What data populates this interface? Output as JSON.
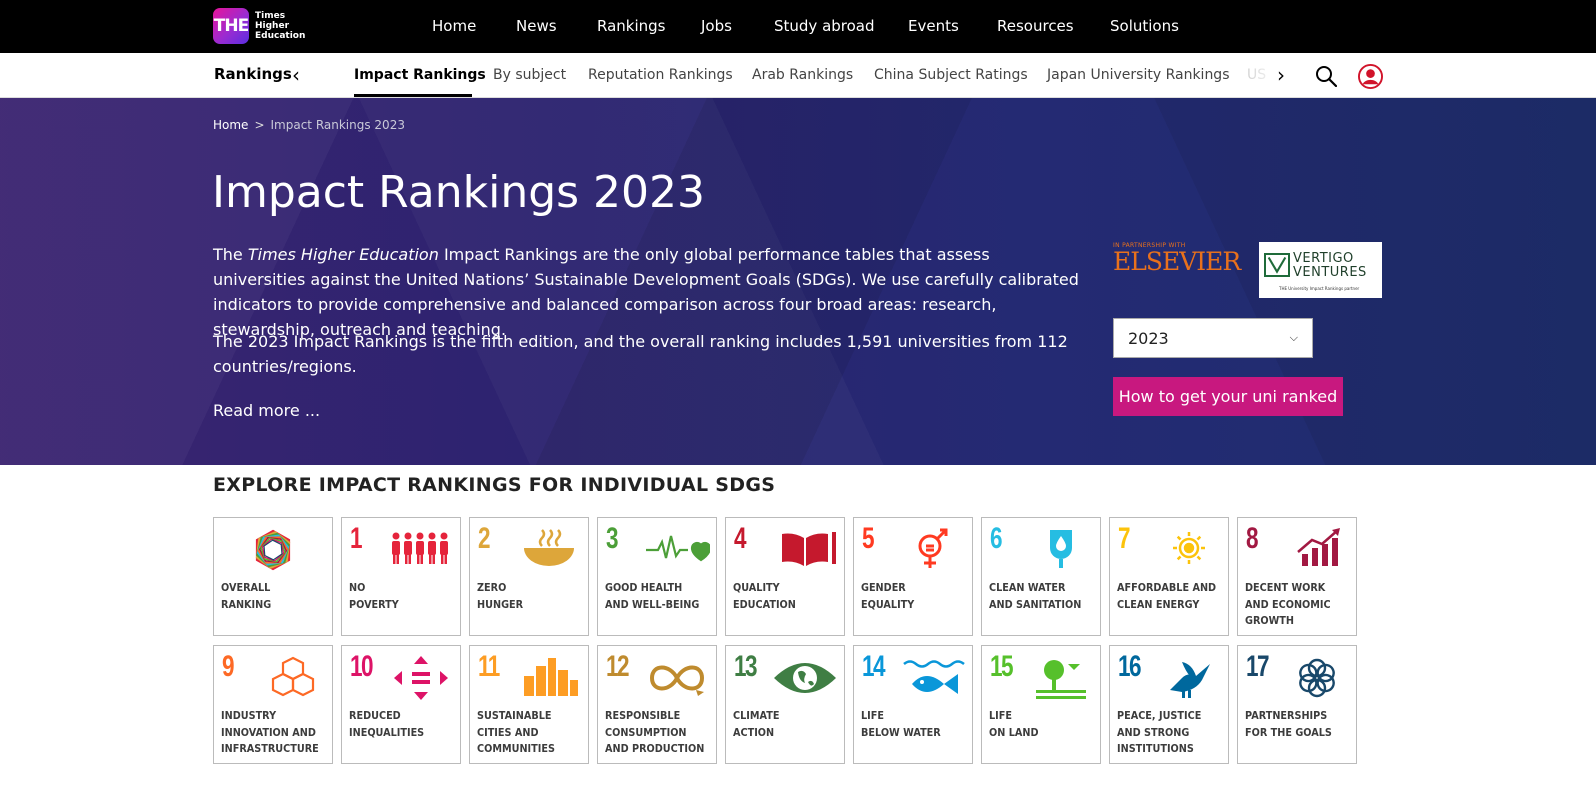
{
  "logo": {
    "mark": "THE",
    "lines": [
      "Times",
      "Higher",
      "Education"
    ]
  },
  "topnav": {
    "items": [
      "Home",
      "News",
      "Rankings",
      "Jobs",
      "Study abroad",
      "Events",
      "Resources",
      "Solutions"
    ]
  },
  "subnav": {
    "title": "Rankings",
    "items": [
      "Impact Rankings",
      "By subject",
      "Reputation Rankings",
      "Arab Rankings",
      "China Subject Ratings",
      "Japan University Rankings",
      "US"
    ],
    "active": "Impact Rankings"
  },
  "breadcrumb": {
    "home": "Home",
    "separator": ">",
    "current": "Impact Rankings 2023"
  },
  "hero": {
    "title": "Impact Rankings 2023",
    "intro_prefix": "The ",
    "intro_italic": "Times Higher Education",
    "intro_suffix": " Impact Rankings are the only global performance tables that assess universities against the United Nations’ Sustainable Development Goals (SDGs). We use carefully calibrated indicators to provide comprehensive and balanced comparison across four broad areas: research, stewardship, outreach and teaching.",
    "intro2": "The 2023 Impact Rankings is the fifth edition, and the overall ranking includes 1,591 universities from 112 countries/regions.",
    "read_more": "Read more ..."
  },
  "partners": {
    "elsevier_small": "IN PARTNERSHIP WITH",
    "elsevier_name": "ELSEVIER",
    "vertigo_line1": "VERTIGO",
    "vertigo_line2": "VENTURES",
    "vertigo_sub": "THE University Impact Rankings partner"
  },
  "year_select": {
    "value": "2023"
  },
  "cta": {
    "label": "How to get your uni ranked"
  },
  "sdg": {
    "heading": "EXPLORE IMPACT RANKINGS FOR INDIVIDUAL SDGS",
    "tiles": [
      {
        "num": "",
        "label": "OVERALL RANKING",
        "color": "#e0a020",
        "icon": "overall-wheel"
      },
      {
        "num": "1",
        "label": "NO POVERTY",
        "color": "#e5243b",
        "icon": "family"
      },
      {
        "num": "2",
        "label": "ZERO HUNGER",
        "color": "#dda63a",
        "icon": "bowl"
      },
      {
        "num": "3",
        "label": "GOOD HEALTH AND WELL-BEING",
        "color": "#4c9f38",
        "icon": "heartbeat"
      },
      {
        "num": "4",
        "label": "QUALITY EDUCATION",
        "color": "#c5192d",
        "icon": "book"
      },
      {
        "num": "5",
        "label": "GENDER EQUALITY",
        "color": "#ff3a21",
        "icon": "gender"
      },
      {
        "num": "6",
        "label": "CLEAN WATER AND SANITATION",
        "color": "#26bde2",
        "icon": "water-drop"
      },
      {
        "num": "7",
        "label": "AFFORDABLE AND CLEAN ENERGY",
        "color": "#fcc30b",
        "icon": "sun"
      },
      {
        "num": "8",
        "label": "DECENT WORK AND ECONOMIC GROWTH",
        "color": "#a21942",
        "icon": "growth-chart"
      },
      {
        "num": "9",
        "label": "INDUSTRY INNOVATION AND INFRASTRUCTURE",
        "color": "#fd6925",
        "icon": "cubes"
      },
      {
        "num": "10",
        "label": "REDUCED INEQUALITIES",
        "color": "#dd1367",
        "icon": "equality-arrows"
      },
      {
        "num": "11",
        "label": "SUSTAINABLE CITIES AND COMMUNITIES",
        "color": "#fd9d24",
        "icon": "city"
      },
      {
        "num": "12",
        "label": "RESPONSIBLE CONSUMPTION AND PRODUCTION",
        "color": "#bf8b2e",
        "icon": "infinity"
      },
      {
        "num": "13",
        "label": "CLIMATE ACTION",
        "color": "#3f7e44",
        "icon": "eye-globe"
      },
      {
        "num": "14",
        "label": "LIFE BELOW WATER",
        "color": "#0a97d9",
        "icon": "fish"
      },
      {
        "num": "15",
        "label": "LIFE ON LAND",
        "color": "#56c02b",
        "icon": "tree"
      },
      {
        "num": "16",
        "label": "PEACE, JUSTICE AND STRONG INSTITUTIONS",
        "color": "#00689d",
        "icon": "dove"
      },
      {
        "num": "17",
        "label": "PARTNERSHIPS FOR THE GOALS",
        "color": "#19486a",
        "icon": "rings"
      }
    ],
    "label_lines": [
      [
        "OVERALL",
        "RANKING"
      ],
      [
        "NO",
        "POVERTY"
      ],
      [
        "ZERO",
        "HUNGER"
      ],
      [
        "GOOD HEALTH",
        "AND WELL-BEING"
      ],
      [
        "QUALITY",
        "EDUCATION"
      ],
      [
        "GENDER",
        "EQUALITY"
      ],
      [
        "CLEAN WATER",
        "AND SANITATION"
      ],
      [
        "AFFORDABLE AND",
        "CLEAN ENERGY"
      ],
      [
        "DECENT WORK",
        "AND ECONOMIC",
        "GROWTH"
      ],
      [
        "INDUSTRY",
        "INNOVATION AND",
        "INFRASTRUCTURE"
      ],
      [
        "REDUCED",
        "INEQUALITIES"
      ],
      [
        "SUSTAINABLE",
        "CITIES AND",
        "COMMUNITIES"
      ],
      [
        "RESPONSIBLE",
        "CONSUMPTION",
        "AND PRODUCTION"
      ],
      [
        "CLIMATE",
        "ACTION"
      ],
      [
        "LIFE",
        "BELOW WATER"
      ],
      [
        "LIFE",
        "ON LAND"
      ],
      [
        "PEACE, JUSTICE",
        "AND STRONG",
        "INSTITUTIONS"
      ],
      [
        "PARTNERSHIPS",
        "FOR THE GOALS"
      ]
    ]
  }
}
